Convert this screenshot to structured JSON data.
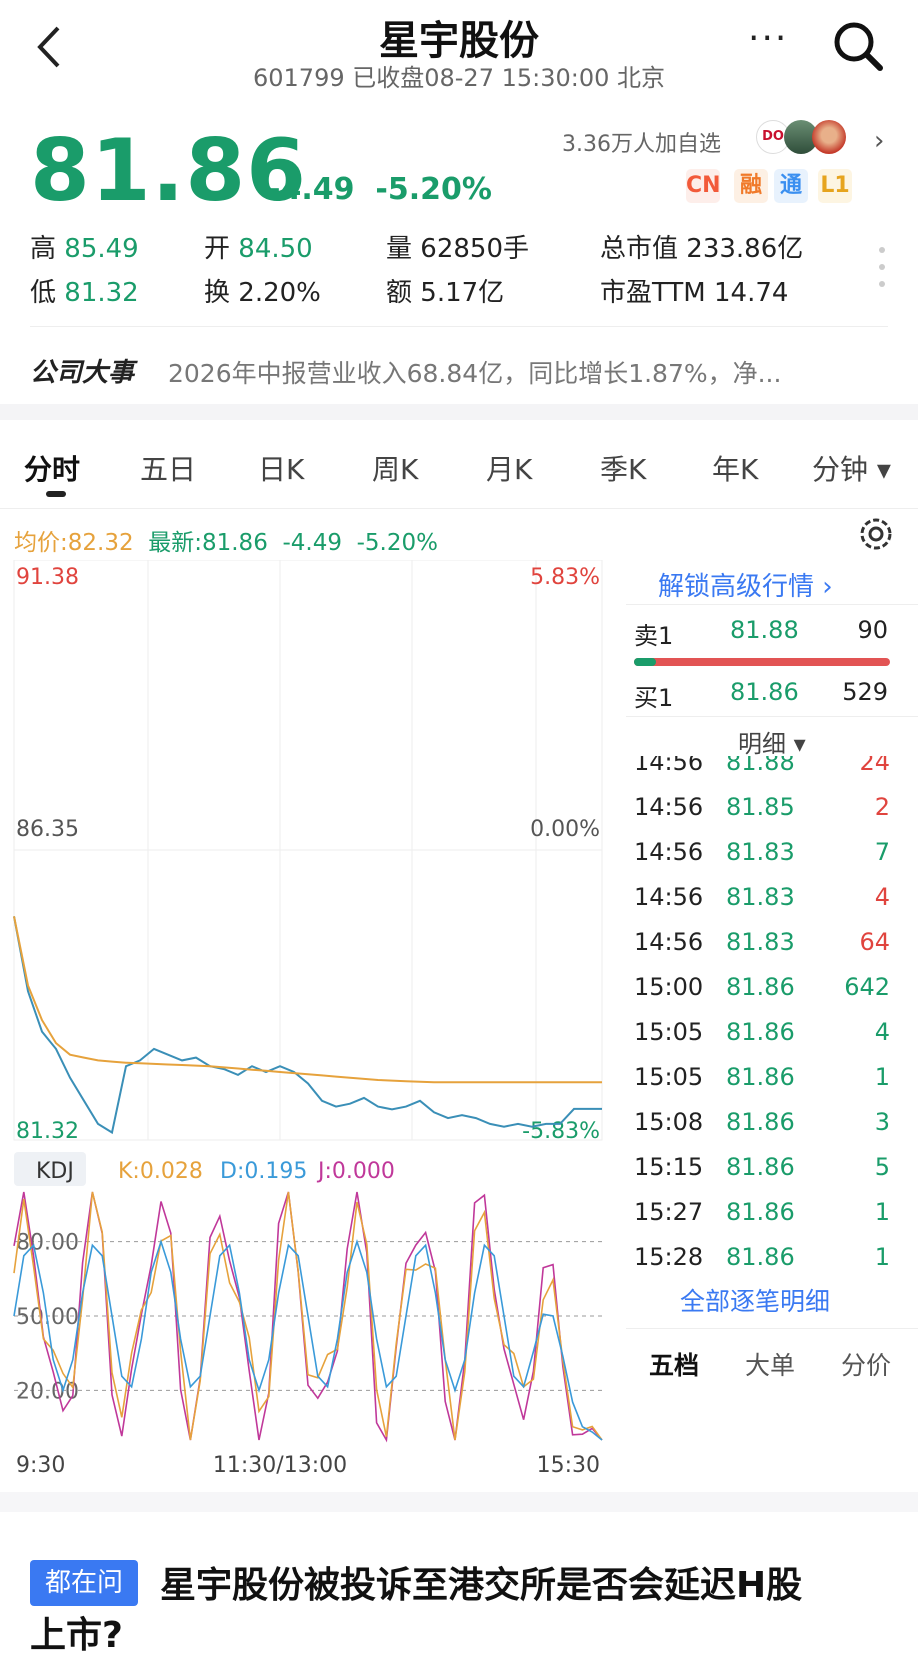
{
  "header": {
    "title": "星宇股份",
    "subtitle": "601799 已收盘08-27 15:30:00 北京",
    "more_label": "···"
  },
  "quote": {
    "price": "81.86",
    "change": "-4.49",
    "change_pct": "-5.20%",
    "followers": "3.36万人加自选",
    "badges": [
      {
        "label": "CN",
        "color": "#f25a3a",
        "bg": "#fdeeea"
      },
      {
        "label": "融",
        "color": "#f07a2a",
        "bg": "#fdf0e4"
      },
      {
        "label": "通",
        "color": "#3a8ff0",
        "bg": "#e8f2fd"
      },
      {
        "label": "L1",
        "color": "#e6a41e",
        "bg": "#fdf5e2"
      }
    ],
    "avatar_text": "DO"
  },
  "stats": {
    "high_label": "高",
    "high": "85.49",
    "open_label": "开",
    "open": "84.50",
    "vol_label": "量",
    "vol": "62850手",
    "mcap_label": "总市值",
    "mcap": "233.86亿",
    "low_label": "低",
    "low": "81.32",
    "turn_label": "换",
    "turn": "2.20%",
    "amt_label": "额",
    "amt": "5.17亿",
    "pe_label": "市盈TTM",
    "pe": "14.74"
  },
  "event": {
    "label": "公司大事",
    "text": "2026年中报营业收入68.84亿，同比增长1.87%，净..."
  },
  "tabs": [
    "分时",
    "五日",
    "日K",
    "周K",
    "月K",
    "季K",
    "年K",
    "分钟 ▾"
  ],
  "avgline": {
    "avg_label": "均价:",
    "avg": "82.32",
    "latest_label": "最新:",
    "latest": "81.86",
    "chg": "-4.49",
    "pct": "-5.20%"
  },
  "chart": {
    "y_top": "91.38",
    "y_mid": "86.35",
    "y_bot": "81.32",
    "pct_top": "5.83%",
    "pct_mid": "0.00%",
    "pct_bot": "-5.83%",
    "kdj_label": "KDJ",
    "k": "K:0.028",
    "d": "D:0.195",
    "j": "J:0.000",
    "kdj_ticks": [
      "80.00",
      "50.00",
      "20.00"
    ],
    "x_labels": [
      "9:30",
      "11:30/13:00",
      "15:30"
    ],
    "colors": {
      "price": "#3a8fb7",
      "avg": "#e6a23c",
      "k": "#e6a23c",
      "d": "#3a9ad9",
      "j": "#c0389a"
    }
  },
  "orderbook": {
    "unlock_label": "解锁高级行情 ›",
    "sell_label": "卖1",
    "sell_price": "81.88",
    "sell_vol": "90",
    "buy_label": "买1",
    "buy_price": "81.86",
    "buy_vol": "529",
    "buy_ratio": 0.087,
    "detail_label": "明细 ▾",
    "ticks": [
      {
        "t": "14:56",
        "p": "81.88",
        "v": "24",
        "c": "red"
      },
      {
        "t": "14:56",
        "p": "81.85",
        "v": "2",
        "c": "red"
      },
      {
        "t": "14:56",
        "p": "81.83",
        "v": "7",
        "c": "green"
      },
      {
        "t": "14:56",
        "p": "81.83",
        "v": "4",
        "c": "red"
      },
      {
        "t": "14:56",
        "p": "81.83",
        "v": "64",
        "c": "red"
      },
      {
        "t": "15:00",
        "p": "81.86",
        "v": "642",
        "c": "green"
      },
      {
        "t": "15:05",
        "p": "81.86",
        "v": "4",
        "c": "green"
      },
      {
        "t": "15:05",
        "p": "81.86",
        "v": "1",
        "c": "green"
      },
      {
        "t": "15:08",
        "p": "81.86",
        "v": "3",
        "c": "green"
      },
      {
        "t": "15:15",
        "p": "81.86",
        "v": "5",
        "c": "green"
      },
      {
        "t": "15:27",
        "p": "81.86",
        "v": "1",
        "c": "green"
      },
      {
        "t": "15:28",
        "p": "81.86",
        "v": "1",
        "c": "green"
      }
    ],
    "all_detail_label": "全部逐笔明细",
    "bottom_tabs": [
      "五档",
      "大单",
      "分价"
    ]
  },
  "news": {
    "badge": "都在问",
    "title": "星宇股份被投诉至港交所是否会延迟H股",
    "title_cont": "上市?"
  }
}
